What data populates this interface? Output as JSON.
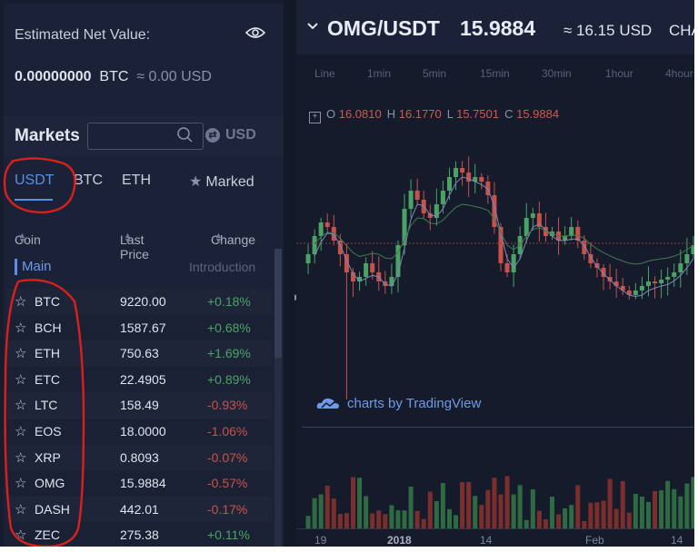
{
  "summary": {
    "estimated_label": "Estimated Net Value:",
    "btc_value": "0.00000000",
    "btc_unit": "BTC",
    "usd_value": "≈ 0.00 USD"
  },
  "markets": {
    "title": "Markets",
    "search_placeholder": "",
    "currency_toggle": "USD"
  },
  "tabs": [
    {
      "label": "USDT",
      "active": true
    },
    {
      "label": "BTC",
      "active": false
    },
    {
      "label": "ETH",
      "active": false
    }
  ],
  "marked_label": "Marked",
  "columns": {
    "coin": "Coin",
    "last_price": "Last Price",
    "change": "Change"
  },
  "section": {
    "label": "Main",
    "intro": "Introduction"
  },
  "coins": [
    {
      "coin": "BTC",
      "price": "9220.00",
      "change": "+0.18%"
    },
    {
      "coin": "BCH",
      "price": "1587.67",
      "change": "+0.68%"
    },
    {
      "coin": "ETH",
      "price": "750.63",
      "change": "+1.69%"
    },
    {
      "coin": "ETC",
      "price": "22.4905",
      "change": "+0.89%"
    },
    {
      "coin": "LTC",
      "price": "158.49",
      "change": "-0.93%"
    },
    {
      "coin": "EOS",
      "price": "18.0000",
      "change": "-1.06%"
    },
    {
      "coin": "XRP",
      "price": "0.8093",
      "change": "-0.07%"
    },
    {
      "coin": "OMG",
      "price": "15.9884",
      "change": "-0.57%"
    },
    {
      "coin": "DASH",
      "price": "442.01",
      "change": "-0.17%"
    },
    {
      "coin": "ZEC",
      "price": "275.38",
      "change": "+0.11%"
    }
  ],
  "ticker": {
    "pair": "OMG/USDT",
    "price": "15.9884",
    "approx": "≈ 16.15 USD",
    "chart_tab": "CHA"
  },
  "intervals": [
    "Line",
    "1min",
    "5min",
    "15min",
    "30min",
    "1hour",
    "4hour"
  ],
  "ohlc": {
    "o": "16.0810",
    "h": "16.1770",
    "l": "15.7501",
    "c": "15.9884"
  },
  "tradingview": "charts by TradingView",
  "xaxis_labels": [
    "19",
    "2018",
    "14",
    "Feb",
    "14"
  ],
  "colors": {
    "up": "#4aa364",
    "down": "#c8524a",
    "accent": "#5b8ee6",
    "annotation": "#d8201c"
  }
}
